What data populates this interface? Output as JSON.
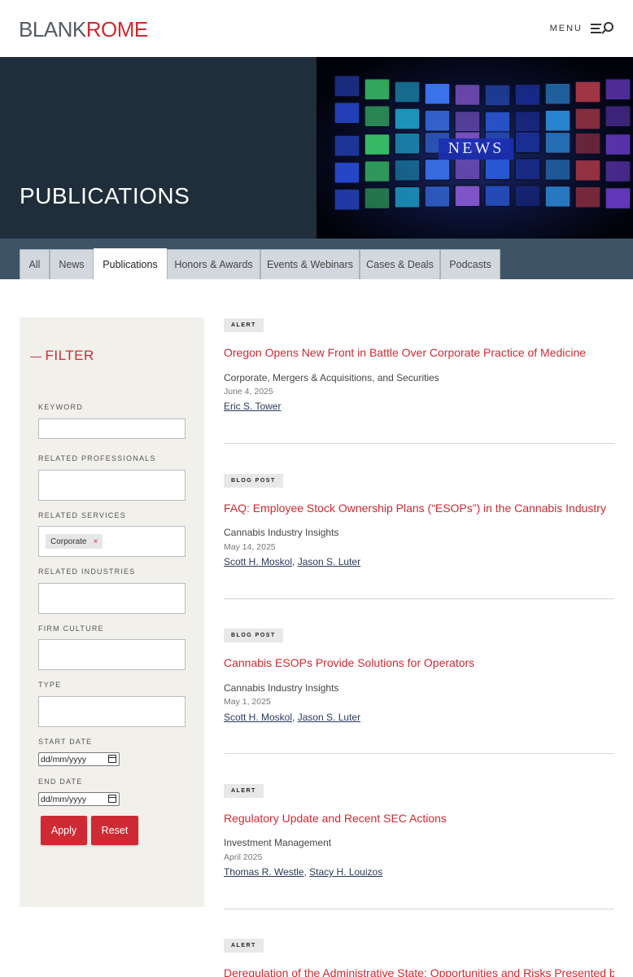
{
  "header": {
    "logo_part1": "BLANK",
    "logo_part2": "ROME",
    "menu_label": "MENU"
  },
  "hero": {
    "title": "PUBLICATIONS",
    "image_text": "NEWS"
  },
  "tabs": [
    {
      "label": "All",
      "active": false
    },
    {
      "label": "News",
      "active": false
    },
    {
      "label": "Publications",
      "active": true
    },
    {
      "label": "Honors & Awards",
      "active": false
    },
    {
      "label": "Events & Webinars",
      "active": false
    },
    {
      "label": "Cases & Deals",
      "active": false
    },
    {
      "label": "Podcasts",
      "active": false
    }
  ],
  "filter": {
    "title": "FILTER",
    "keyword_label": "KEYWORD",
    "professionals_label": "RELATED PROFESSIONALS",
    "services_label": "RELATED SERVICES",
    "services_chip": "Corporate",
    "chip_remove": "×",
    "industries_label": "RELATED INDUSTRIES",
    "culture_label": "FIRM CULTURE",
    "type_label": "TYPE",
    "start_label": "START DATE",
    "start_value": "dd/mm/yyyy",
    "end_label": "END DATE",
    "end_value": "dd/mm/yyyy",
    "apply_label": "Apply",
    "reset_label": "Reset"
  },
  "articles": [
    {
      "badge": "ALERT",
      "title": "Oregon Opens New Front in Battle Over Corporate Practice of Medicine",
      "subtitle": "Corporate, Mergers & Acquisitions, and Securities",
      "date": "June 4, 2025",
      "authors": [
        "Eric S. Tower"
      ]
    },
    {
      "badge": "BLOG POST",
      "title": "FAQ: Employee Stock Ownership Plans (“ESOPs”) in the Cannabis Industry",
      "subtitle": "Cannabis Industry Insights",
      "date": "May 14, 2025",
      "authors": [
        "Scott H. Moskol",
        "Jason S. Luter"
      ]
    },
    {
      "badge": "BLOG POST",
      "title": "Cannabis ESOPs Provide Solutions for Operators",
      "subtitle": "Cannabis Industry Insights",
      "date": "May 1, 2025",
      "authors": [
        "Scott H. Moskol",
        "Jason S. Luter"
      ]
    },
    {
      "badge": "ALERT",
      "title": "Regulatory Update and Recent SEC Actions",
      "subtitle": "Investment Management",
      "date": "April 2025",
      "authors": [
        "Thomas R. Westle",
        "Stacy H. Louizos"
      ]
    },
    {
      "badge": "ALERT",
      "title": "Deregulation of the Administrative State: Opportunities and Risks Presented by",
      "subtitle": "",
      "date": "",
      "authors": []
    }
  ],
  "author_separator": ", ",
  "colors": {
    "brand_red": "#cf2a33",
    "hero_bg": "#1f2e3a",
    "tabbar_bg": "#3e5366",
    "sidebar_bg": "#f1f0eb"
  }
}
